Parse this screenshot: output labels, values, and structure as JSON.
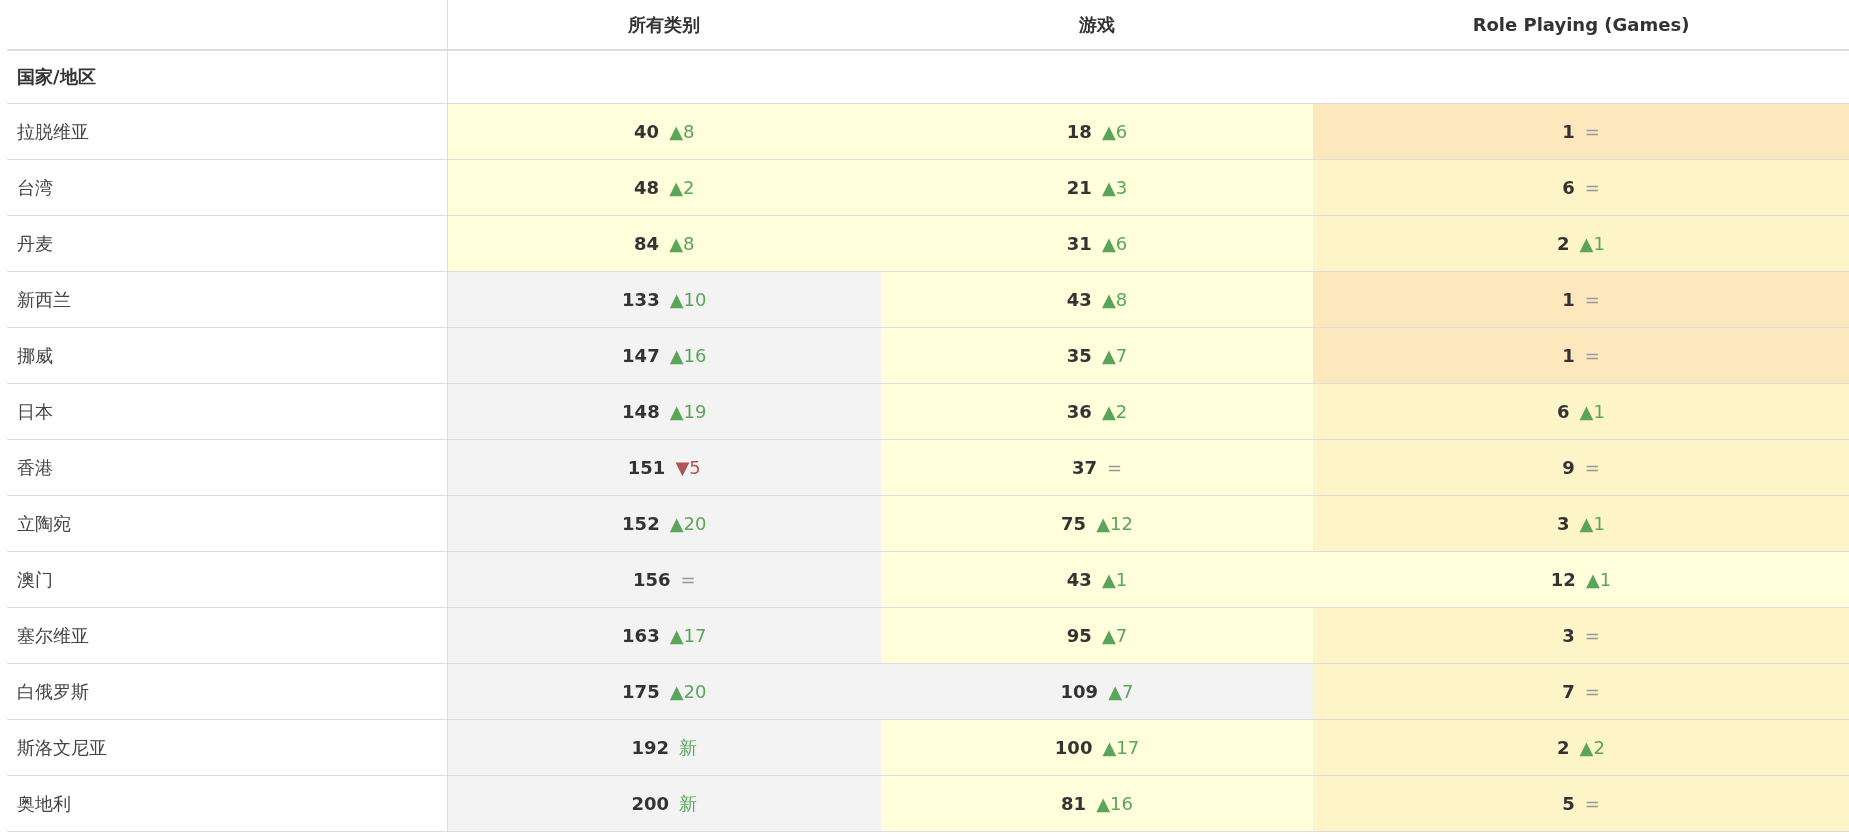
{
  "table": {
    "columns": [
      "所有类别",
      "游戏",
      "Role Playing (Games)"
    ],
    "row_header": "国家/地区",
    "rows": [
      {
        "country": "拉脱维亚",
        "cells": [
          {
            "rank": "40",
            "change": {
              "kind": "up",
              "text": "▲8"
            },
            "color": "#ffffdc"
          },
          {
            "rank": "18",
            "change": {
              "kind": "up",
              "text": "▲6"
            },
            "color": "#ffffdc"
          },
          {
            "rank": "1",
            "change": {
              "kind": "same",
              "text": "="
            },
            "color": "#fde8be"
          }
        ]
      },
      {
        "country": "台湾",
        "cells": [
          {
            "rank": "48",
            "change": {
              "kind": "up",
              "text": "▲2"
            },
            "color": "#ffffdc"
          },
          {
            "rank": "21",
            "change": {
              "kind": "up",
              "text": "▲3"
            },
            "color": "#ffffdc"
          },
          {
            "rank": "6",
            "change": {
              "kind": "same",
              "text": "="
            },
            "color": "#fdf5c8"
          }
        ]
      },
      {
        "country": "丹麦",
        "cells": [
          {
            "rank": "84",
            "change": {
              "kind": "up",
              "text": "▲8"
            },
            "color": "#ffffdc"
          },
          {
            "rank": "31",
            "change": {
              "kind": "up",
              "text": "▲6"
            },
            "color": "#ffffdc"
          },
          {
            "rank": "2",
            "change": {
              "kind": "up",
              "text": "▲1"
            },
            "color": "#fdf5c8"
          }
        ]
      },
      {
        "country": "新西兰",
        "cells": [
          {
            "rank": "133",
            "change": {
              "kind": "up",
              "text": "▲10"
            },
            "color": "#f3f3f3"
          },
          {
            "rank": "43",
            "change": {
              "kind": "up",
              "text": "▲8"
            },
            "color": "#ffffdc"
          },
          {
            "rank": "1",
            "change": {
              "kind": "same",
              "text": "="
            },
            "color": "#fde8be"
          }
        ]
      },
      {
        "country": "挪威",
        "cells": [
          {
            "rank": "147",
            "change": {
              "kind": "up",
              "text": "▲16"
            },
            "color": "#f3f3f3"
          },
          {
            "rank": "35",
            "change": {
              "kind": "up",
              "text": "▲7"
            },
            "color": "#ffffdc"
          },
          {
            "rank": "1",
            "change": {
              "kind": "same",
              "text": "="
            },
            "color": "#fde8be"
          }
        ]
      },
      {
        "country": "日本",
        "cells": [
          {
            "rank": "148",
            "change": {
              "kind": "up",
              "text": "▲19"
            },
            "color": "#f3f3f3"
          },
          {
            "rank": "36",
            "change": {
              "kind": "up",
              "text": "▲2"
            },
            "color": "#ffffdc"
          },
          {
            "rank": "6",
            "change": {
              "kind": "up",
              "text": "▲1"
            },
            "color": "#fdf5c8"
          }
        ]
      },
      {
        "country": "香港",
        "cells": [
          {
            "rank": "151",
            "change": {
              "kind": "down",
              "text": "▼5"
            },
            "color": "#f3f3f3"
          },
          {
            "rank": "37",
            "change": {
              "kind": "same",
              "text": "="
            },
            "color": "#ffffdc"
          },
          {
            "rank": "9",
            "change": {
              "kind": "same",
              "text": "="
            },
            "color": "#fdf5c8"
          }
        ]
      },
      {
        "country": "立陶宛",
        "cells": [
          {
            "rank": "152",
            "change": {
              "kind": "up",
              "text": "▲20"
            },
            "color": "#f3f3f3"
          },
          {
            "rank": "75",
            "change": {
              "kind": "up",
              "text": "▲12"
            },
            "color": "#ffffdc"
          },
          {
            "rank": "3",
            "change": {
              "kind": "up",
              "text": "▲1"
            },
            "color": "#fdf5c8"
          }
        ]
      },
      {
        "country": "澳门",
        "cells": [
          {
            "rank": "156",
            "change": {
              "kind": "same",
              "text": "="
            },
            "color": "#f3f3f3"
          },
          {
            "rank": "43",
            "change": {
              "kind": "up",
              "text": "▲1"
            },
            "color": "#ffffdc"
          },
          {
            "rank": "12",
            "change": {
              "kind": "up",
              "text": "▲1"
            },
            "color": "#ffffdc"
          }
        ]
      },
      {
        "country": "塞尔维亚",
        "cells": [
          {
            "rank": "163",
            "change": {
              "kind": "up",
              "text": "▲17"
            },
            "color": "#f3f3f3"
          },
          {
            "rank": "95",
            "change": {
              "kind": "up",
              "text": "▲7"
            },
            "color": "#ffffdc"
          },
          {
            "rank": "3",
            "change": {
              "kind": "same",
              "text": "="
            },
            "color": "#fdf5c8"
          }
        ]
      },
      {
        "country": "白俄罗斯",
        "cells": [
          {
            "rank": "175",
            "change": {
              "kind": "up",
              "text": "▲20"
            },
            "color": "#f3f3f3"
          },
          {
            "rank": "109",
            "change": {
              "kind": "up",
              "text": "▲7"
            },
            "color": "#f3f3f3"
          },
          {
            "rank": "7",
            "change": {
              "kind": "same",
              "text": "="
            },
            "color": "#fdf5c8"
          }
        ]
      },
      {
        "country": "斯洛文尼亚",
        "cells": [
          {
            "rank": "192",
            "change": {
              "kind": "new",
              "text": "新"
            },
            "color": "#f3f3f3"
          },
          {
            "rank": "100",
            "change": {
              "kind": "up",
              "text": "▲17"
            },
            "color": "#ffffdc"
          },
          {
            "rank": "2",
            "change": {
              "kind": "up",
              "text": "▲2"
            },
            "color": "#fdf5c8"
          }
        ]
      },
      {
        "country": "奥地利",
        "cells": [
          {
            "rank": "200",
            "change": {
              "kind": "new",
              "text": "新"
            },
            "color": "#f3f3f3"
          },
          {
            "rank": "81",
            "change": {
              "kind": "up",
              "text": "▲16"
            },
            "color": "#ffffdc"
          },
          {
            "rank": "5",
            "change": {
              "kind": "same",
              "text": "="
            },
            "color": "#fdf5c8"
          }
        ]
      }
    ]
  }
}
